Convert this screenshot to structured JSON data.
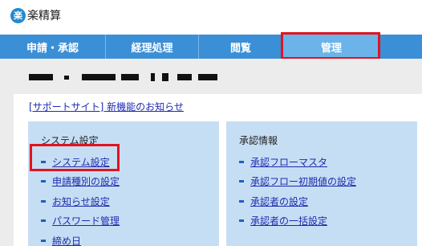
{
  "app": {
    "logo_glyph": "楽",
    "logo_text": "楽精算",
    "brand_color": "#1f8ad4"
  },
  "nav": {
    "items": [
      {
        "label": "申請・承認"
      },
      {
        "label": "経理処理"
      },
      {
        "label": "閲覧"
      },
      {
        "label": "管理",
        "active": true
      }
    ]
  },
  "news": {
    "link_label": "[サポートサイト] 新機能のお知らせ"
  },
  "system_settings": {
    "title": "システム設定",
    "items": [
      {
        "label": "システム設定"
      },
      {
        "label": "申請種別の設定"
      },
      {
        "label": "お知らせ設定"
      },
      {
        "label": "パスワード管理"
      },
      {
        "label": "締め日"
      }
    ]
  },
  "approval_info": {
    "title": "承認情報",
    "items": [
      {
        "label": "承認フローマスタ"
      },
      {
        "label": "承認フロー初期値の設定"
      },
      {
        "label": "承認者の設定"
      },
      {
        "label": "承認者の一括設定"
      }
    ]
  },
  "colors": {
    "nav_bg": "#3a8fd6",
    "nav_active": "#6bb3e9",
    "highlight": "#e0141e",
    "link": "#1e2bb0",
    "box_bg": "#c6def3"
  }
}
